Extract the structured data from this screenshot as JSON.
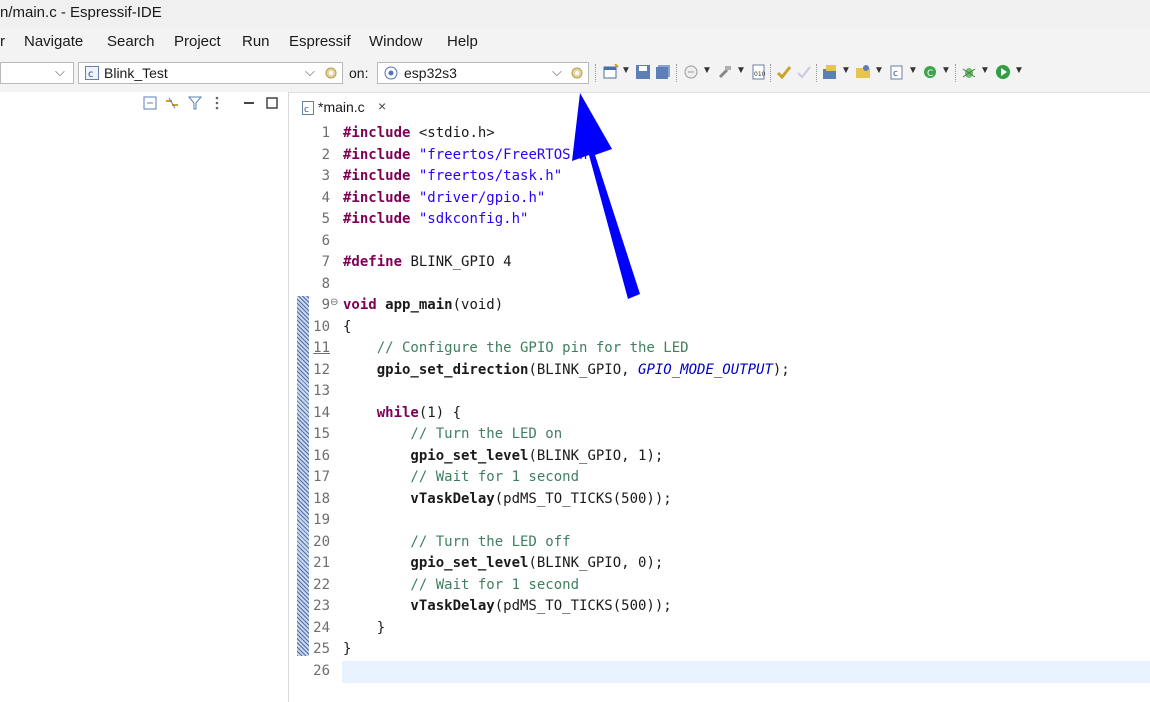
{
  "window": {
    "title": "n/main.c - Espressif-IDE"
  },
  "menu": {
    "items": [
      "r",
      "Navigate",
      "Search",
      "Project",
      "Run",
      "Espressif",
      "Window",
      "Help"
    ]
  },
  "toolbar": {
    "launch_config": "Blink_Test",
    "on_label": "on:",
    "target": "esp32s3"
  },
  "editor": {
    "tab_label": "*main.c",
    "line_numbers": [
      "1",
      "2",
      "3",
      "4",
      "5",
      "6",
      "7",
      "8",
      "9",
      "10",
      "11",
      "12",
      "13",
      "14",
      "15",
      "16",
      "17",
      "18",
      "19",
      "20",
      "21",
      "22",
      "23",
      "24",
      "25",
      "26"
    ],
    "lines": [
      {
        "kw": "#include",
        "rest": " <stdio.h>"
      },
      {
        "kw": "#include",
        "rest": " \"freertos/FreeRTOS.h\""
      },
      {
        "kw": "#include",
        "rest": " \"freertos/task.h\""
      },
      {
        "kw": "#include",
        "rest": " \"driver/gpio.h\""
      },
      {
        "kw": "#include",
        "rest": " \"sdkconfig.h\""
      },
      {
        "kw": "#define",
        "rest": " BLINK_GPIO 4"
      },
      {
        "kw": "void",
        "fn": "app_main",
        "rest": "(void)"
      },
      {
        "text": "{"
      },
      {
        "cm": "    // Configure the GPIO pin for the LED"
      },
      {
        "fn": "    gpio_set_direction",
        "rest": "(BLINK_GPIO, ",
        "it": "GPIO_MODE_OUTPUT",
        "end": ");"
      },
      {
        "kw": "    while",
        "rest": "(1) {"
      },
      {
        "cm": "        // Turn the LED on"
      },
      {
        "fn": "        gpio_set_level",
        "rest": "(BLINK_GPIO, 1);"
      },
      {
        "cm": "        // Wait for 1 second"
      },
      {
        "fn": "        vTaskDelay",
        "rest": "(pdMS_TO_TICKS(500));"
      },
      {
        "cm": "        // Turn the LED off"
      },
      {
        "fn": "        gpio_set_level",
        "rest": "(BLINK_GPIO, 0);"
      },
      {
        "cm": "        // Wait for 1 second"
      },
      {
        "fn": "        vTaskDelay",
        "rest": "(pdMS_TO_TICKS(500));"
      },
      {
        "text": "    }"
      },
      {
        "text": "}"
      }
    ]
  },
  "annotation": {
    "arrow_color": "#0000ff"
  },
  "colors": {
    "keyword": "#7f0055",
    "string": "#2a00ff",
    "comment": "#3f7f5f"
  }
}
